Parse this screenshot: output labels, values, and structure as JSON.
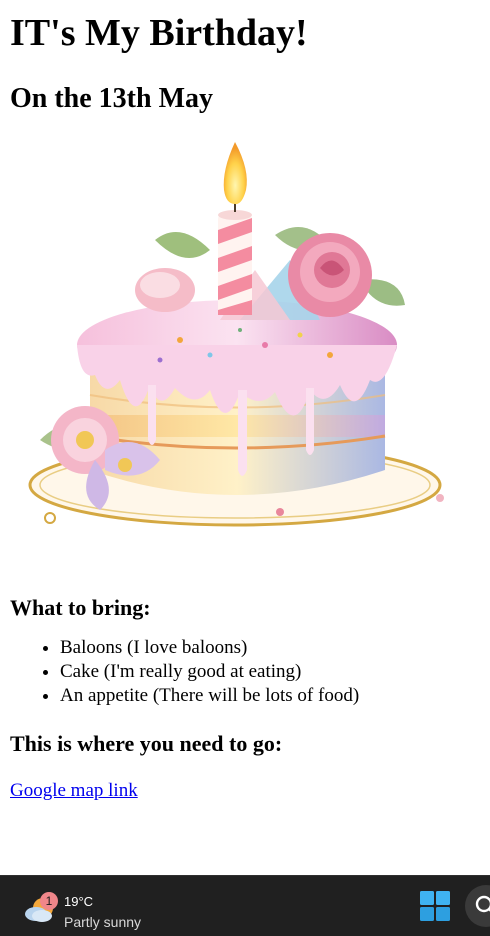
{
  "page": {
    "title": "IT's My Birthday!",
    "date_heading": "On the 13th May",
    "bring_heading": "What to bring:",
    "bring_items": [
      "Baloons (I love baloons)",
      "Cake (I'm really good at eating)",
      "An appetite (There will be lots of food)"
    ],
    "go_heading": "This is where you need to go:",
    "map_link": "Google map link",
    "cake_image": "watercolor-birthday-cake-icon"
  },
  "taskbar": {
    "weather_badge": "1",
    "temperature": "19°C",
    "condition": "Partly sunny",
    "weather_icon": "partly-sunny-icon",
    "start_icon": "windows-start-icon",
    "search_icon": "search-icon",
    "colors": {
      "background": "#202020",
      "start": "#3fb3f1",
      "badge": "#f0868a"
    }
  },
  "colors": {
    "link": "#0000ee",
    "text": "#000000"
  }
}
